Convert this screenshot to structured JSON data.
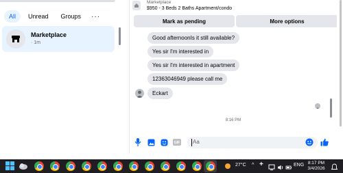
{
  "filters": {
    "all": "All",
    "unread": "Unread",
    "groups": "Groups",
    "more": "···"
  },
  "conversation": {
    "name": "Marketplace",
    "time": "· 1m"
  },
  "listing": {
    "label": "Marketplace",
    "title": "$950 - 3 Beds 2 Baths Apartment/condo"
  },
  "actions": {
    "mark_pending": "Mark as pending",
    "more_options": "More options"
  },
  "messages": [
    "Good afternoonIs it still available?",
    "Yes sir I'm interested in",
    "Yes sir I'm interested in apartment",
    "12363046949 please call me",
    "Eckart"
  ],
  "timestamp": "8:16 PM",
  "composer": {
    "placeholder": "Aa"
  },
  "taskbar": {
    "temperature": "27°C",
    "language": "ENG",
    "time": "8:17 PM",
    "date": "3/4/2026"
  },
  "colors": {
    "accent": "#0866ff",
    "selected_bg": "#e7f3ff",
    "bubble": "#e4e6eb",
    "taskbar": "#1f1f23"
  }
}
